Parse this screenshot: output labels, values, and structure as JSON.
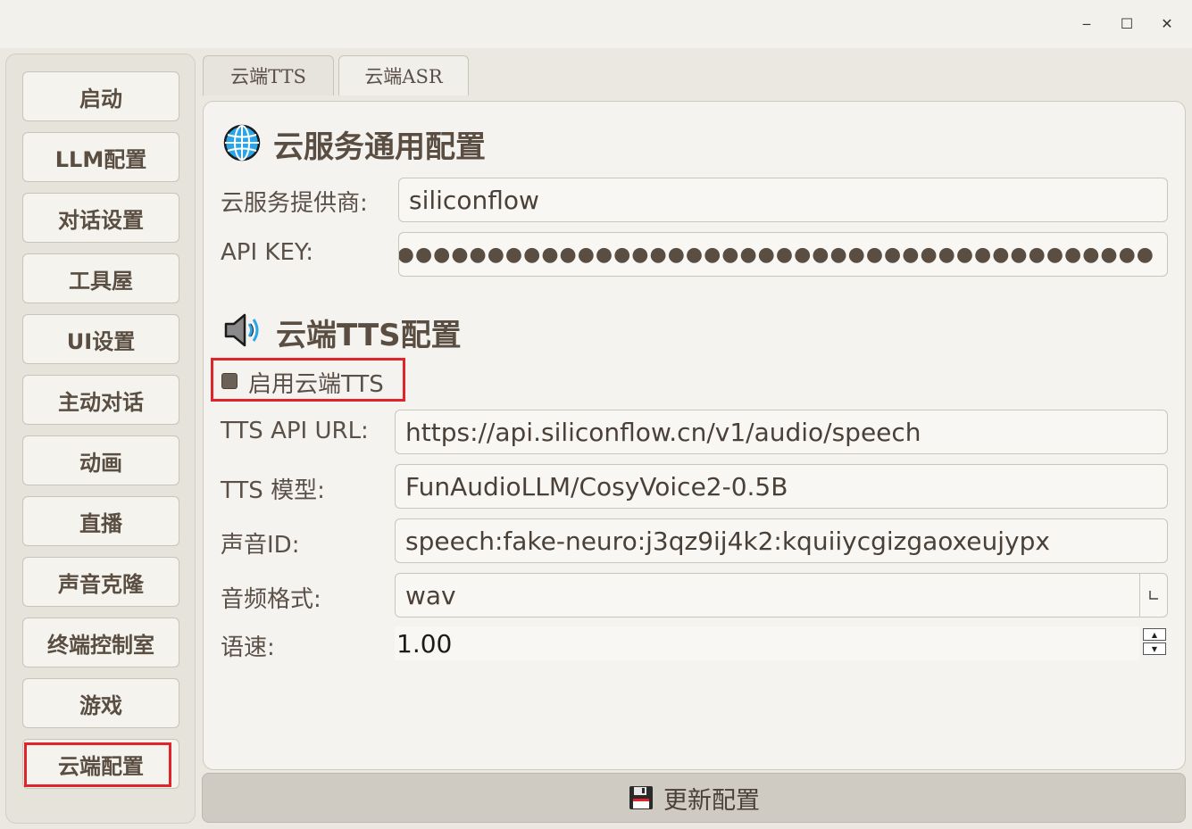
{
  "window": {
    "minimize_glyph": "‒",
    "maximize_glyph": "☐",
    "close_glyph": "✕"
  },
  "sidebar": {
    "items": [
      {
        "label": "启动"
      },
      {
        "label": "LLM配置"
      },
      {
        "label": "对话设置"
      },
      {
        "label": "工具屋"
      },
      {
        "label": "UI设置"
      },
      {
        "label": "主动对话"
      },
      {
        "label": "动画"
      },
      {
        "label": "直播"
      },
      {
        "label": "声音克隆"
      },
      {
        "label": "终端控制室"
      },
      {
        "label": "游戏"
      },
      {
        "label": "云端配置"
      }
    ],
    "active_index": 11
  },
  "tabs": [
    {
      "label": "云端TTS",
      "active": true
    },
    {
      "label": "云端ASR",
      "active": false
    }
  ],
  "cloud_common": {
    "title": "云服务通用配置",
    "icon": "globe-icon",
    "provider_label": "云服务提供商:",
    "provider_value": "siliconflow",
    "api_key_label": "API KEY:",
    "api_key_masked": "●●●●●●●●●●●●●●●●●●●●●●●●●●●●●●●●●●●●●●●●●●●●●●●●●●●"
  },
  "cloud_tts": {
    "title": "云端TTS配置",
    "icon": "speaker-icon",
    "enable_label": "启用云端TTS",
    "enabled": false,
    "url_label": "TTS API URL:",
    "url_value": "https://api.siliconflow.cn/v1/audio/speech",
    "model_label": "TTS 模型:",
    "model_value": "FunAudioLLM/CosyVoice2-0.5B",
    "voice_label": "声音ID:",
    "voice_value": "speech:fake-neuro:j3qz9ij4k2:kquiiycgizgaoxeujypx",
    "format_label": "音频格式:",
    "format_value": "wav",
    "speed_label": "语速:",
    "speed_value": "1.00"
  },
  "footer": {
    "update_label": "更新配置",
    "icon": "save-disk-icon"
  },
  "colors": {
    "highlight": "#e0242b",
    "text": "#5a4e42",
    "background": "#ebe8e1"
  }
}
